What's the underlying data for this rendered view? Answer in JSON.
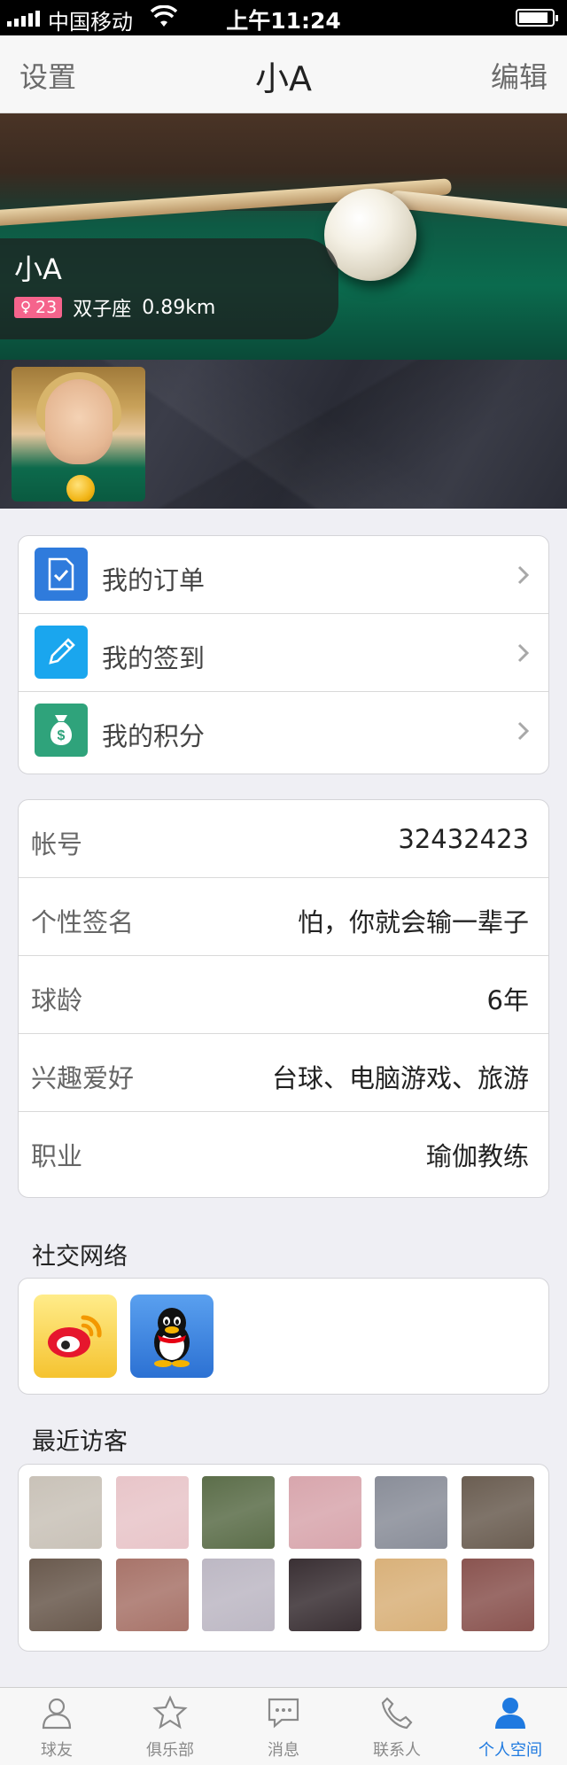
{
  "status_bar": {
    "carrier": "中国移动",
    "time": "上午11:24"
  },
  "nav": {
    "left": "设置",
    "title": "小A",
    "right": "编辑"
  },
  "profile": {
    "name": "小A",
    "age_badge": "23",
    "zodiac": "双子座",
    "distance": "0.89km"
  },
  "menu": [
    {
      "label": "我的订单",
      "icon": "order-check-icon",
      "color": "#2f7bdc"
    },
    {
      "label": "我的签到",
      "icon": "pencil-icon",
      "color": "#1aa6ee"
    },
    {
      "label": "我的积分",
      "icon": "money-bag-icon",
      "color": "#2fa37b"
    }
  ],
  "info": [
    {
      "key": "帐号",
      "value": "32432423"
    },
    {
      "key": "个性签名",
      "value": "怕，你就会输一辈子"
    },
    {
      "key": "球龄",
      "value": "6年"
    },
    {
      "key": "兴趣爱好",
      "value": "台球、电脑游戏、旅游"
    },
    {
      "key": "职业",
      "value": "瑜伽教练"
    }
  ],
  "social": {
    "title": "社交网络",
    "items": [
      "weibo-icon",
      "qq-icon"
    ]
  },
  "visitors": {
    "title": "最近访客",
    "colors": [
      "#c9c2b8",
      "#e8c5c9",
      "#5c6e4a",
      "#d8a6ad",
      "#8a8e99",
      "#6b5e52",
      "#6a5a4e",
      "#a8746a",
      "#bdb8c4",
      "#3a3034",
      "#d9b17a",
      "#8a5450"
    ]
  },
  "tabs": [
    {
      "label": "球友",
      "icon": "person-outline-icon",
      "active": false
    },
    {
      "label": "俱乐部",
      "icon": "star-badge-icon",
      "active": false
    },
    {
      "label": "消息",
      "icon": "chat-bubble-icon",
      "active": false
    },
    {
      "label": "联系人",
      "icon": "phone-icon",
      "active": false
    },
    {
      "label": "个人空间",
      "icon": "person-filled-icon",
      "active": true
    }
  ],
  "colors": {
    "accent": "#1f7ae0",
    "badge": "#f5648c"
  }
}
